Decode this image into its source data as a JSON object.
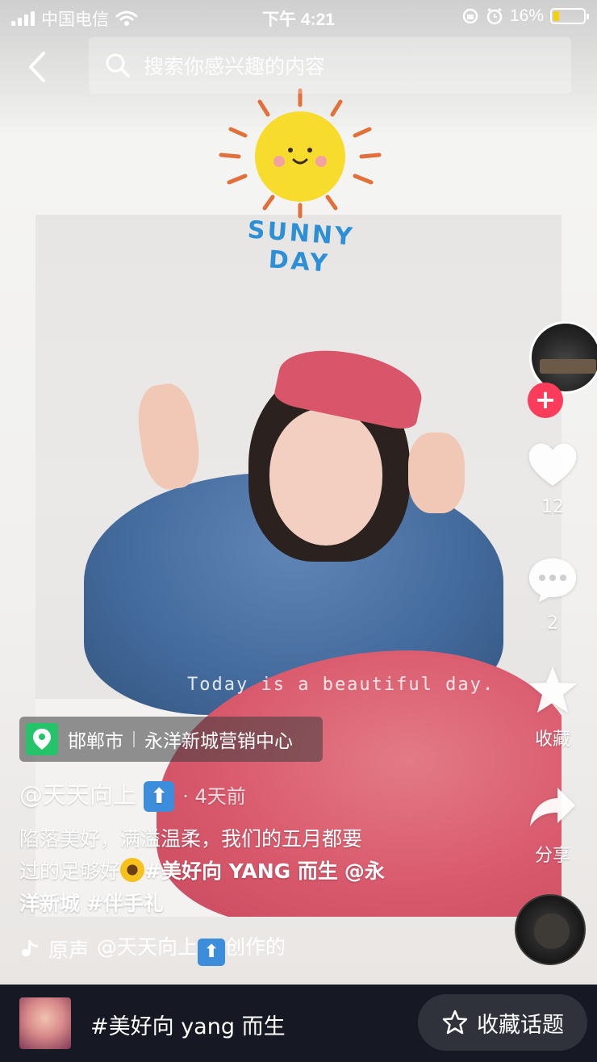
{
  "status_bar": {
    "carrier": "中国电信",
    "time": "下午 4:21",
    "battery_percent": "16%",
    "battery_level": 0.16,
    "battery_color": "#f6d100"
  },
  "search": {
    "placeholder": "搜索你感兴趣的内容"
  },
  "sticker": {
    "text": "SUNNY DAY"
  },
  "video": {
    "overlay_text": "Today is a beautiful day."
  },
  "rail": {
    "likes": "12",
    "comments": "2",
    "favorite_label": "收藏",
    "share_label": "分享",
    "follow_color": "#fd3b5a"
  },
  "location": {
    "city": "邯郸市",
    "place": "永洋新城营销中心"
  },
  "post": {
    "author": "@天天向上",
    "author_emoji": "⬆",
    "time_ago": "· 4天前",
    "caption_line1": "陷落美好，满溢温柔，我们的五月都要",
    "caption_line2_a": "过的足够好",
    "caption_tag1": "#美好向 YANG 而生",
    "caption_mention": "@永",
    "caption_line3_a": "洋新城",
    "caption_tag2": "#伴手礼"
  },
  "music": {
    "prefix": "原声",
    "author": "@天天向上",
    "suffix": "创作的"
  },
  "bottom_bar": {
    "topic": "#美好向 yang 而生",
    "favorite_topic_label": "收藏话题",
    "background": "#161823"
  },
  "icons": {
    "back": "chevron-left-icon",
    "search": "search-icon",
    "like": "heart-icon",
    "comment": "comment-icon",
    "favorite": "star-icon",
    "share": "share-arrow-icon",
    "location": "location-pin-icon",
    "music": "music-note-icon"
  }
}
